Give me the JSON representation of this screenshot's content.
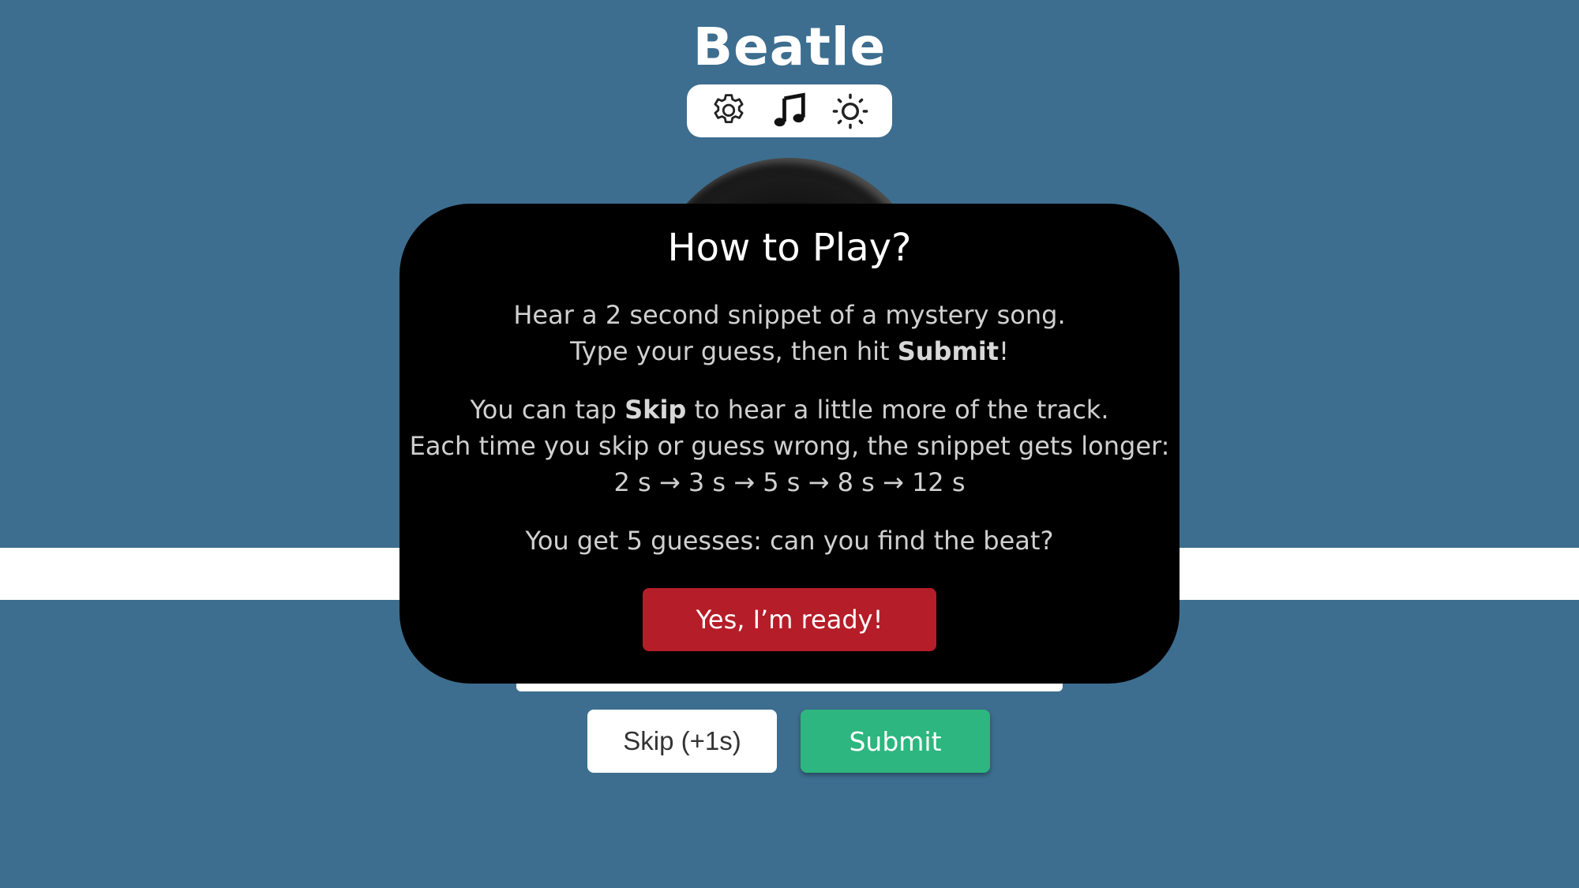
{
  "app": {
    "title": "Beatle"
  },
  "toolbar": {
    "icons": [
      "gear-icon",
      "music-note-icon",
      "sun-icon"
    ]
  },
  "guess": {
    "value": "",
    "placeholder": ""
  },
  "buttons": {
    "skip_label": "Skip (+1s)",
    "submit_label": "Submit"
  },
  "modal": {
    "title": "How to Play?",
    "p1_line1": "Hear a 2 second snippet of a mystery song.",
    "p1_line2_before": "Type your guess, then hit ",
    "p1_line2_bold": "Submit",
    "p1_line2_after": "!",
    "p2_line1_before": "You can tap ",
    "p2_line1_bold": "Skip",
    "p2_line1_after": " to hear a little more of the track.",
    "p2_line2": "Each time you skip or guess wrong, the snippet gets longer:",
    "p2_line3": "2 s → 3 s → 5 s → 8 s → 12 s",
    "p3": "You get 5 guesses: can you find the beat?",
    "ready_label": "Yes, I’m ready!"
  },
  "colors": {
    "background": "#3d6e8f",
    "modal_bg": "#000000",
    "ready_button": "#b51d28",
    "submit_button": "#2db67f"
  }
}
